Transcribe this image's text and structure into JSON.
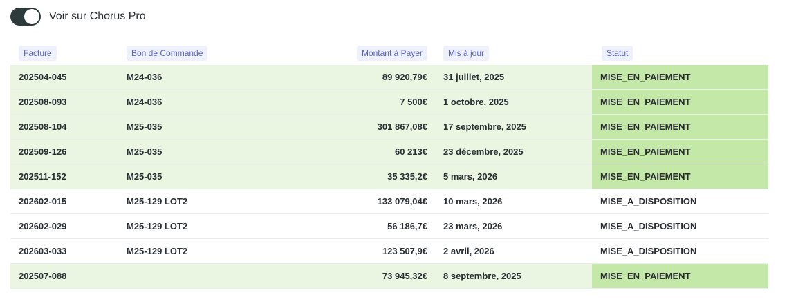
{
  "toggle": {
    "label": "Voir sur Chorus Pro",
    "on": true
  },
  "columns": [
    "Facture",
    "Bon de Commande",
    "Montant à Payer",
    "Mis à jour",
    "Statut"
  ],
  "rows": [
    {
      "facture": "202504-045",
      "bon": "M24-036",
      "montant": "89 920,79€",
      "maj": "31 juillet, 2025",
      "statut": "MISE_EN_PAIEMENT",
      "highlight": true
    },
    {
      "facture": "202508-093",
      "bon": "M24-036",
      "montant": "7 500€",
      "maj": "1 octobre, 2025",
      "statut": "MISE_EN_PAIEMENT",
      "highlight": true
    },
    {
      "facture": "202508-104",
      "bon": "M25-035",
      "montant": "301 867,08€",
      "maj": "17 septembre, 2025",
      "statut": "MISE_EN_PAIEMENT",
      "highlight": true
    },
    {
      "facture": "202509-126",
      "bon": "M25-035",
      "montant": "60 213€",
      "maj": "23 décembre, 2025",
      "statut": "MISE_EN_PAIEMENT",
      "highlight": true
    },
    {
      "facture": "202511-152",
      "bon": "M25-035",
      "montant": "35 335,2€",
      "maj": "5 mars, 2026",
      "statut": "MISE_EN_PAIEMENT",
      "highlight": true
    },
    {
      "facture": "202602-015",
      "bon": "M25-129 LOT2",
      "montant": "133 079,04€",
      "maj": "10 mars, 2026",
      "statut": "MISE_A_DISPOSITION",
      "highlight": false
    },
    {
      "facture": "202602-029",
      "bon": "M25-129 LOT2",
      "montant": "56 186,7€",
      "maj": "23 mars, 2026",
      "statut": "MISE_A_DISPOSITION",
      "highlight": false
    },
    {
      "facture": "202603-033",
      "bon": "M25-129 LOT2",
      "montant": "123 507,9€",
      "maj": "2 avril, 2026",
      "statut": "MISE_A_DISPOSITION",
      "highlight": false
    },
    {
      "facture": "202507-088",
      "bon": "",
      "montant": "73 945,32€",
      "maj": "8 septembre, 2025",
      "statut": "MISE_EN_PAIEMENT",
      "highlight": true
    }
  ],
  "colors": {
    "row_green": "#eaf6e2",
    "status_green": "#c4e8a7",
    "header_chip": "#eef0fb",
    "header_text": "#5a63c7",
    "toggle_on": "#2f3a3c"
  }
}
